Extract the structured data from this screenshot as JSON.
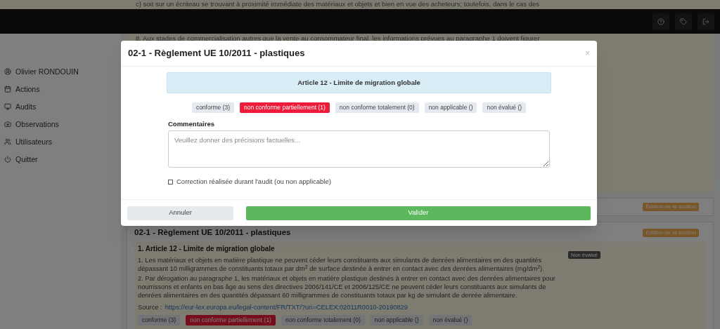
{
  "background": {
    "top_text": "c) soit sur un écriteau se trouvant à proximité immédiate des matériaux et objets et bien en vue des acheteurs; toutefois, dans le cas des",
    "header_buttons": [
      {
        "kind": "help"
      },
      {
        "kind": "tag"
      },
      {
        "kind": "logout"
      }
    ],
    "paragraph_8": "8.  Aux stades de commercialisation autres que la vente au consommateur final, les informations prévues au paragraphe 1 doivent figurer",
    "sidebar": {
      "items": [
        {
          "label": "Olivier RONDOUIN"
        },
        {
          "label": "Actions"
        },
        {
          "label": "Audits"
        },
        {
          "label": "Observations"
        },
        {
          "label": "Utilisateurs"
        },
        {
          "label": "Quitter"
        }
      ]
    },
    "sections": [
      {
        "edit_badge": "Édition de la section"
      },
      {
        "title": "02-1 - Règlement UE 10/2011 - plastiques",
        "edit_badge": "Édition de la section"
      }
    ],
    "article": {
      "title": "1. Article 12 - Limite de migration globale",
      "status": "Non évalué",
      "paragraphs": [
        "1.  Les matériaux et objets en matière plastique ne peuvent céder leurs constituants aux simulants de denrées alimentaires en des quantités dépassant 10 milligrammes de constituants totaux par dm$^{2}$ de surface destinée à entrer en contact avec des denrées alimentaires (mg/dm$^{2}$).",
        "2.  Par dérogation au paragraphe 1, les matériaux et objets en matière plastique destinés à entrer en contact avec des denrées alimentaires pour nourrissons et enfants en bas âge au sens des directives 2006/141/CE et 2006/125/CE ne peuvent céder leurs constituants aux simulants de denrées alimentaires en des quantités dépassant 60 milligrammes de constituants totaux par kg de simulant de denrée alimentaire."
      ],
      "source_label": "Source :",
      "source_link": "https://eur-lex.europa.eu/legal-content/FR/TXT/?uri=CELEX:02011R0010-20190829",
      "ratings": [
        {
          "label": "conforme (3)",
          "selected": false
        },
        {
          "label": "non conforme partiellement (1)",
          "selected": true
        },
        {
          "label": "non conforme totalement (0)",
          "selected": false
        },
        {
          "label": "non applicable ()",
          "selected": false
        },
        {
          "label": "non évalué ()",
          "selected": false
        }
      ]
    }
  },
  "dialog": {
    "title": "02-1 - Règlement UE 10/2011 - plastiques",
    "close": "×",
    "article": "Article 12 - Limite de migration globale",
    "ratings": [
      {
        "label": "conforme (3)",
        "selected": false
      },
      {
        "label": "non conforme partiellement (1)",
        "selected": true
      },
      {
        "label": "non conforme totalement (0)",
        "selected": false
      },
      {
        "label": "non applicable ()",
        "selected": false
      },
      {
        "label": "non évalué ()",
        "selected": false
      }
    ],
    "comments_label": "Commentaires",
    "comments_placeholder": "Veuillez donner des précisions factuelles...",
    "correction": {
      "label": "Correction réalisée durant l'audit (ou non applicable)",
      "checked": false
    },
    "buttons": {
      "cancel": "Annuler",
      "submit": "Valider"
    }
  }
}
